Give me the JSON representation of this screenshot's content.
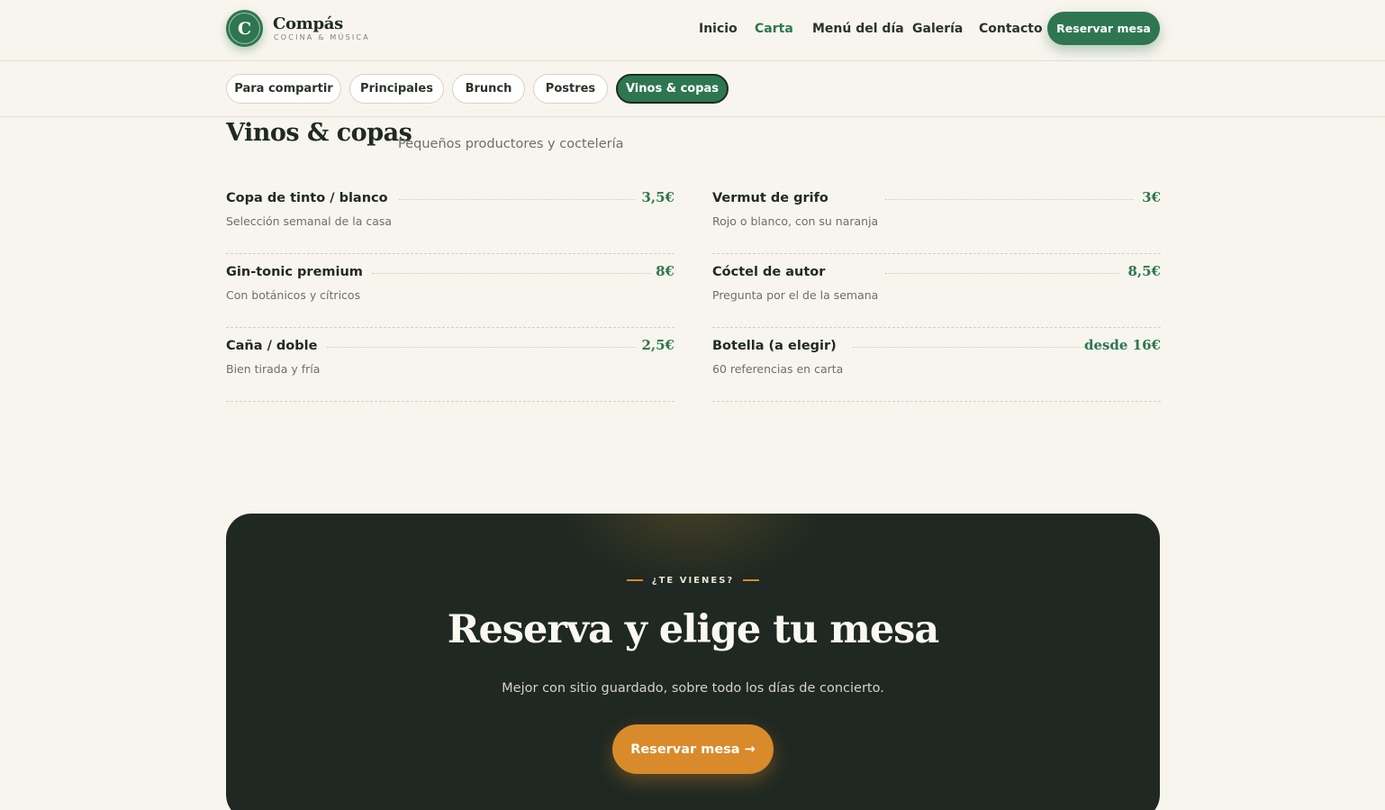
{
  "brand": {
    "logo_letter": "C",
    "name": "Compás",
    "tagline": "COCINA & MÚSICA"
  },
  "nav": {
    "items": [
      "Inicio",
      "Carta",
      "Menú del día",
      "Galería",
      "Contacto"
    ],
    "active": "Carta",
    "cta_label": "Reservar mesa"
  },
  "tabs": {
    "items": [
      "Para compartir",
      "Principales",
      "Brunch",
      "Postres",
      "Vinos & copas"
    ],
    "active": "Vinos & copas"
  },
  "section": {
    "title": "Vinos & copas",
    "subtitle": "Pequeños productores y coctelería",
    "items": [
      {
        "name": "Copa de tinto / blanco",
        "desc": "Selección semanal de la casa",
        "price": "3,5€"
      },
      {
        "name": "Vermut de grifo",
        "desc": "Rojo o blanco, con su naranja",
        "price": "3€"
      },
      {
        "name": "Gin-tonic premium",
        "desc": "Con botánicos y cítricos",
        "price": "8€"
      },
      {
        "name": "Cóctel de autor",
        "desc": "Pregunta por el de la semana",
        "price": "8,5€"
      },
      {
        "name": "Caña / doble",
        "desc": "Bien tirada y fría",
        "price": "2,5€"
      },
      {
        "name": "Botella (a elegir)",
        "desc": "60 referencias en carta",
        "price": "desde 16€"
      }
    ]
  },
  "cta": {
    "eyebrow": "¿TE VIENES?",
    "title": "Reserva y elige tu mesa",
    "subtitle": "Mejor con sitio guardado, sobre todo los días de concierto.",
    "button_label": "Reservar mesa →"
  },
  "colors": {
    "accent": "#2e7650",
    "cta_bg": "#1f2822",
    "cta_button": "#d98a2b",
    "background": "#f8f5ef"
  }
}
